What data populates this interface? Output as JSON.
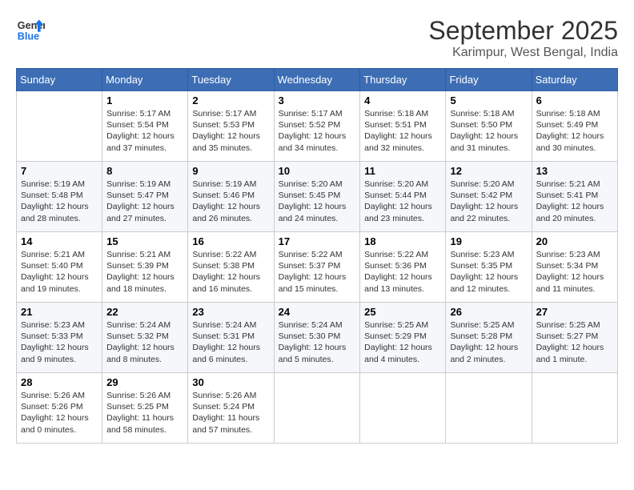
{
  "header": {
    "logo_line1": "General",
    "logo_line2": "Blue",
    "month": "September 2025",
    "location": "Karimpur, West Bengal, India"
  },
  "weekdays": [
    "Sunday",
    "Monday",
    "Tuesday",
    "Wednesday",
    "Thursday",
    "Friday",
    "Saturday"
  ],
  "weeks": [
    [
      {
        "day": "",
        "info": ""
      },
      {
        "day": "1",
        "info": "Sunrise: 5:17 AM\nSunset: 5:54 PM\nDaylight: 12 hours\nand 37 minutes."
      },
      {
        "day": "2",
        "info": "Sunrise: 5:17 AM\nSunset: 5:53 PM\nDaylight: 12 hours\nand 35 minutes."
      },
      {
        "day": "3",
        "info": "Sunrise: 5:17 AM\nSunset: 5:52 PM\nDaylight: 12 hours\nand 34 minutes."
      },
      {
        "day": "4",
        "info": "Sunrise: 5:18 AM\nSunset: 5:51 PM\nDaylight: 12 hours\nand 32 minutes."
      },
      {
        "day": "5",
        "info": "Sunrise: 5:18 AM\nSunset: 5:50 PM\nDaylight: 12 hours\nand 31 minutes."
      },
      {
        "day": "6",
        "info": "Sunrise: 5:18 AM\nSunset: 5:49 PM\nDaylight: 12 hours\nand 30 minutes."
      }
    ],
    [
      {
        "day": "7",
        "info": "Sunrise: 5:19 AM\nSunset: 5:48 PM\nDaylight: 12 hours\nand 28 minutes."
      },
      {
        "day": "8",
        "info": "Sunrise: 5:19 AM\nSunset: 5:47 PM\nDaylight: 12 hours\nand 27 minutes."
      },
      {
        "day": "9",
        "info": "Sunrise: 5:19 AM\nSunset: 5:46 PM\nDaylight: 12 hours\nand 26 minutes."
      },
      {
        "day": "10",
        "info": "Sunrise: 5:20 AM\nSunset: 5:45 PM\nDaylight: 12 hours\nand 24 minutes."
      },
      {
        "day": "11",
        "info": "Sunrise: 5:20 AM\nSunset: 5:44 PM\nDaylight: 12 hours\nand 23 minutes."
      },
      {
        "day": "12",
        "info": "Sunrise: 5:20 AM\nSunset: 5:42 PM\nDaylight: 12 hours\nand 22 minutes."
      },
      {
        "day": "13",
        "info": "Sunrise: 5:21 AM\nSunset: 5:41 PM\nDaylight: 12 hours\nand 20 minutes."
      }
    ],
    [
      {
        "day": "14",
        "info": "Sunrise: 5:21 AM\nSunset: 5:40 PM\nDaylight: 12 hours\nand 19 minutes."
      },
      {
        "day": "15",
        "info": "Sunrise: 5:21 AM\nSunset: 5:39 PM\nDaylight: 12 hours\nand 18 minutes."
      },
      {
        "day": "16",
        "info": "Sunrise: 5:22 AM\nSunset: 5:38 PM\nDaylight: 12 hours\nand 16 minutes."
      },
      {
        "day": "17",
        "info": "Sunrise: 5:22 AM\nSunset: 5:37 PM\nDaylight: 12 hours\nand 15 minutes."
      },
      {
        "day": "18",
        "info": "Sunrise: 5:22 AM\nSunset: 5:36 PM\nDaylight: 12 hours\nand 13 minutes."
      },
      {
        "day": "19",
        "info": "Sunrise: 5:23 AM\nSunset: 5:35 PM\nDaylight: 12 hours\nand 12 minutes."
      },
      {
        "day": "20",
        "info": "Sunrise: 5:23 AM\nSunset: 5:34 PM\nDaylight: 12 hours\nand 11 minutes."
      }
    ],
    [
      {
        "day": "21",
        "info": "Sunrise: 5:23 AM\nSunset: 5:33 PM\nDaylight: 12 hours\nand 9 minutes."
      },
      {
        "day": "22",
        "info": "Sunrise: 5:24 AM\nSunset: 5:32 PM\nDaylight: 12 hours\nand 8 minutes."
      },
      {
        "day": "23",
        "info": "Sunrise: 5:24 AM\nSunset: 5:31 PM\nDaylight: 12 hours\nand 6 minutes."
      },
      {
        "day": "24",
        "info": "Sunrise: 5:24 AM\nSunset: 5:30 PM\nDaylight: 12 hours\nand 5 minutes."
      },
      {
        "day": "25",
        "info": "Sunrise: 5:25 AM\nSunset: 5:29 PM\nDaylight: 12 hours\nand 4 minutes."
      },
      {
        "day": "26",
        "info": "Sunrise: 5:25 AM\nSunset: 5:28 PM\nDaylight: 12 hours\nand 2 minutes."
      },
      {
        "day": "27",
        "info": "Sunrise: 5:25 AM\nSunset: 5:27 PM\nDaylight: 12 hours\nand 1 minute."
      }
    ],
    [
      {
        "day": "28",
        "info": "Sunrise: 5:26 AM\nSunset: 5:26 PM\nDaylight: 12 hours\nand 0 minutes."
      },
      {
        "day": "29",
        "info": "Sunrise: 5:26 AM\nSunset: 5:25 PM\nDaylight: 11 hours\nand 58 minutes."
      },
      {
        "day": "30",
        "info": "Sunrise: 5:26 AM\nSunset: 5:24 PM\nDaylight: 11 hours\nand 57 minutes."
      },
      {
        "day": "",
        "info": ""
      },
      {
        "day": "",
        "info": ""
      },
      {
        "day": "",
        "info": ""
      },
      {
        "day": "",
        "info": ""
      }
    ]
  ]
}
